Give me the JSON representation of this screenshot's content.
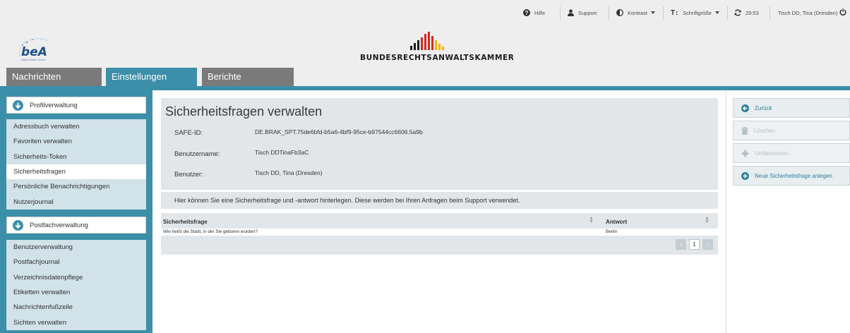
{
  "topbar": {
    "help": "Hilfe",
    "support": "Support",
    "contrast": "Kontrast",
    "fontsize": "Schriftgröße",
    "timer": "29:53",
    "user": "Tisch DD, Tina (Dresden)"
  },
  "header": {
    "org_name": "BUNDESRECHTSANWALTSKAMMER",
    "logo_text": "beA",
    "logo_subtext": "Digital Einfach Sicher"
  },
  "tabs": [
    {
      "label": "Nachrichten"
    },
    {
      "label": "Einstellungen"
    },
    {
      "label": "Berichte"
    }
  ],
  "sidebar": {
    "group1": {
      "title": "Profilverwaltung",
      "items": [
        {
          "label": "Adressbuch verwalten"
        },
        {
          "label": "Favoriten verwalten"
        },
        {
          "label": "Sicherheits-Token"
        },
        {
          "label": "Sicherheitsfragen"
        },
        {
          "label": "Persönliche Benachrichtigungen"
        },
        {
          "label": "Nutzerjournal"
        }
      ]
    },
    "group2": {
      "title": "Postfachverwaltung",
      "items": [
        {
          "label": "Benutzerverwaltung"
        },
        {
          "label": "Postfachjournal"
        },
        {
          "label": "Verzeichnisdatenpflege"
        },
        {
          "label": "Etiketten verwalten"
        },
        {
          "label": "Nachrichtenfußzeile"
        },
        {
          "label": "Sichten verwalten"
        }
      ]
    }
  },
  "main": {
    "title": "Sicherheitsfragen verwalten",
    "safe_id_label": "SAFE-ID:",
    "safe_id_value": "DE.BRAK_SPT.75de6bfd-b5a6-4bf9-95ce-b97544cc6606.5a9b",
    "username_label": "Benutzername:",
    "username_value": "Tisch DDTinaFb3aC",
    "user_label": "Benutzer:",
    "user_value": "Tisch DD, Tina (Dresden)",
    "description": "Hier können Sie eine Sicherheitsfrage und -antwort hinterlegen. Diese werden bei Ihren Anfragen beim Support verwendet.",
    "table": {
      "columns": [
        "Sicherheitsfrage",
        "Antwort"
      ],
      "rows": [
        {
          "question": "Wie heißt die Stadt, in der Sie geboren wurden?",
          "answer": "Berlin"
        }
      ],
      "page": "1"
    }
  },
  "actions": {
    "back": "Zurück",
    "delete": "Löschen",
    "rename": "Umbenennen",
    "new": "Neue Sicherheitsfrage anlegen"
  },
  "colors": {
    "accent": "#3b8fa9",
    "sidebar_bg": "#d1e2e9",
    "panel_bg": "#e3e6e8",
    "brak_red": "#d42a1f",
    "brak_yellow": "#f2b600"
  }
}
